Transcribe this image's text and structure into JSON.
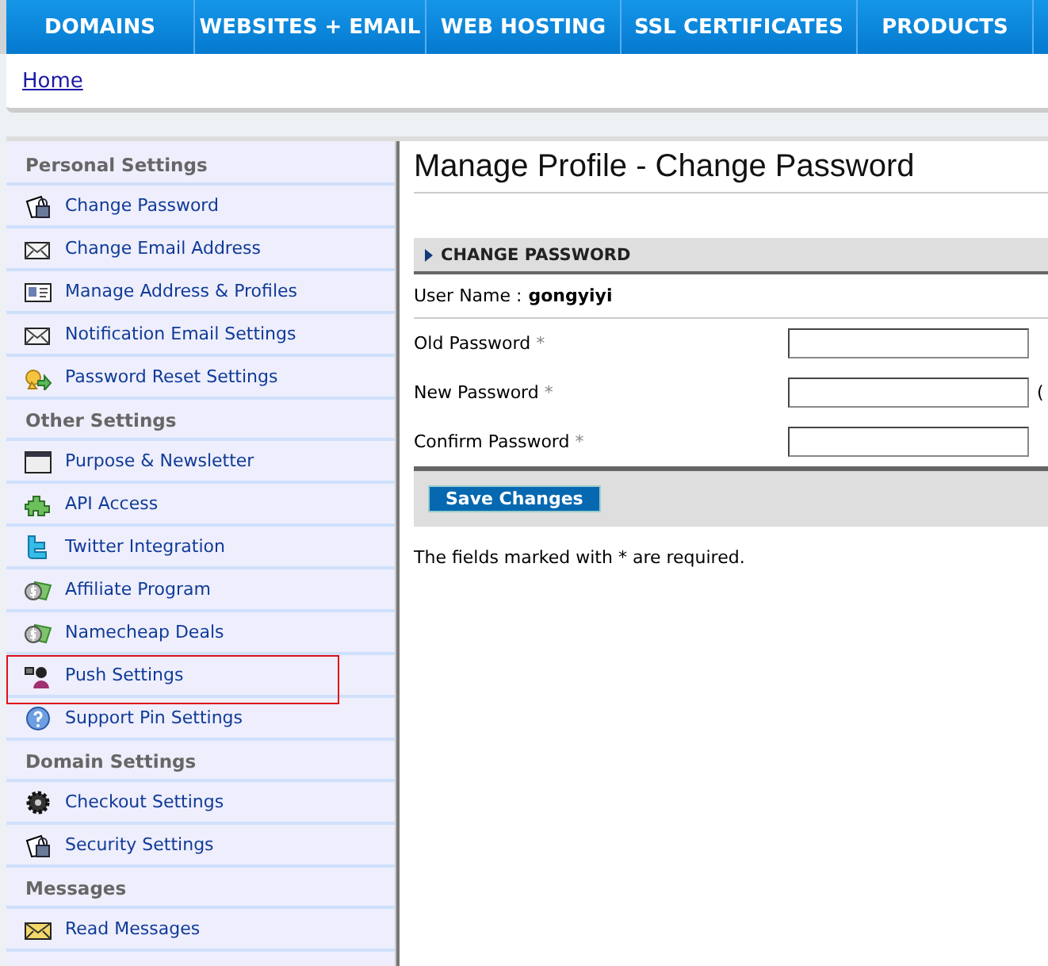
{
  "nav": [
    {
      "label": "DOMAINS"
    },
    {
      "label": "WEBSITES + EMAIL"
    },
    {
      "label": "WEB HOSTING"
    },
    {
      "label": "SSL CERTIFICATES"
    },
    {
      "label": "PRODUCTS"
    }
  ],
  "breadcrumb": "Home",
  "sidebar": [
    {
      "title": "Personal Settings",
      "items": [
        {
          "label": "Change Password",
          "kind": "lock",
          "highlighted": false
        },
        {
          "label": "Change Email Address",
          "kind": "envelope",
          "highlighted": false
        },
        {
          "label": "Manage Address & Profiles",
          "kind": "card",
          "highlighted": false
        },
        {
          "label": "Notification Email Settings",
          "kind": "envelope",
          "highlighted": false
        },
        {
          "label": "Password Reset Settings",
          "kind": "key",
          "highlighted": false
        }
      ]
    },
    {
      "title": "Other Settings",
      "items": [
        {
          "label": "Purpose & Newsletter",
          "kind": "window",
          "highlighted": false
        },
        {
          "label": "API Access",
          "kind": "puzzle",
          "highlighted": false
        },
        {
          "label": "Twitter Integration",
          "kind": "twitter",
          "highlighted": false
        },
        {
          "label": "Affiliate Program",
          "kind": "money",
          "highlighted": false
        },
        {
          "label": "Namecheap Deals",
          "kind": "money",
          "highlighted": false
        },
        {
          "label": "Push Settings",
          "kind": "person",
          "highlighted": true
        },
        {
          "label": "Support Pin Settings",
          "kind": "help",
          "highlighted": false
        }
      ]
    },
    {
      "title": "Domain Settings",
      "items": [
        {
          "label": "Checkout Settings",
          "kind": "gear",
          "highlighted": false
        },
        {
          "label": "Security Settings",
          "kind": "lock",
          "highlighted": false
        }
      ]
    },
    {
      "title": "Messages",
      "items": [
        {
          "label": "Read Messages",
          "kind": "mail",
          "highlighted": false
        }
      ]
    }
  ],
  "main": {
    "title": "Manage Profile - Change Password",
    "section": "CHANGE PASSWORD",
    "user_label": "User Name :",
    "user_value": "gongyiyi",
    "fields": [
      {
        "label": "Old Password",
        "required_mark": "*"
      },
      {
        "label": "New Password",
        "required_mark": "*",
        "hint": "("
      },
      {
        "label": "Confirm Password",
        "required_mark": "*"
      }
    ],
    "save_button": "Save Changes",
    "note": "The fields marked with * are required."
  }
}
